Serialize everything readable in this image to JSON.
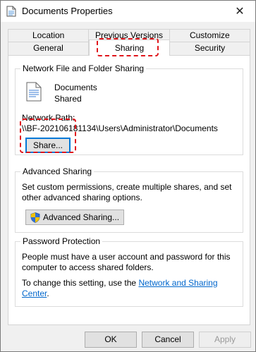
{
  "window": {
    "title": "Documents Properties"
  },
  "tabs": {
    "back": [
      "Location",
      "Previous Versions",
      "Customize"
    ],
    "front": [
      "General",
      "Sharing",
      "Security"
    ]
  },
  "network_sharing": {
    "heading": "Network File and Folder Sharing",
    "item_name": "Documents",
    "item_status": "Shared",
    "path_label": "Network Path:",
    "path_value": "\\\\BF-202106181134\\Users\\Administrator\\Documents",
    "share_button": "Share..."
  },
  "advanced_sharing": {
    "heading": "Advanced Sharing",
    "description": "Set custom permissions, create multiple shares, and set other advanced sharing options.",
    "button": "Advanced Sharing..."
  },
  "password_protection": {
    "heading": "Password Protection",
    "description": "People must have a user account and password for this computer to access shared folders.",
    "change_prefix": "To change this setting, use the ",
    "link": "Network and Sharing Center",
    "change_suffix": "."
  },
  "footer": {
    "ok": "OK",
    "cancel": "Cancel",
    "apply": "Apply"
  },
  "colors": {
    "highlight": "#e0151b",
    "link": "#0066cc",
    "focus": "#0078d7"
  }
}
